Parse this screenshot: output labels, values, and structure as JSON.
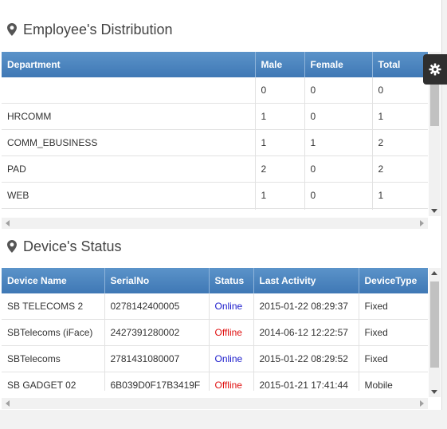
{
  "employee_distribution": {
    "title": "Employee's Distribution",
    "columns": [
      "Department",
      "Male",
      "Female",
      "Total"
    ],
    "rows": [
      [
        "",
        "0",
        "0",
        "0"
      ],
      [
        "HRCOMM",
        "1",
        "0",
        "1"
      ],
      [
        "COMM_EBUSINESS",
        "1",
        "1",
        "2"
      ],
      [
        "PAD",
        "2",
        "0",
        "2"
      ],
      [
        "WEB",
        "1",
        "0",
        "1"
      ],
      [
        "",
        "",
        "",
        ""
      ]
    ]
  },
  "device_status": {
    "title": "Device's Status",
    "columns": [
      "Device Name",
      "SerialNo",
      "Status",
      "Last Activity",
      "DeviceType"
    ],
    "rows": [
      [
        "SB TELECOMS 2",
        "0278142400005",
        "Online",
        "2015-01-22 08:29:37",
        "Fixed"
      ],
      [
        "SBTelecoms (iFace)",
        "2427391280002",
        "Offline",
        "2014-06-12 12:22:57",
        "Fixed"
      ],
      [
        "SBTelecoms",
        "2781431080007",
        "Online",
        "2015-01-22 08:29:52",
        "Fixed"
      ],
      [
        "SB GADGET 02",
        "6B039D0F17B3419F",
        "Offline",
        "2015-01-21 17:41:44",
        "Mobile"
      ]
    ]
  },
  "icons": {
    "section": "map-marker-icon",
    "settings": "gear-icon"
  },
  "colors": {
    "header_bg": "#4a86c0",
    "online": "#1a1acb",
    "offline": "#e01010"
  }
}
